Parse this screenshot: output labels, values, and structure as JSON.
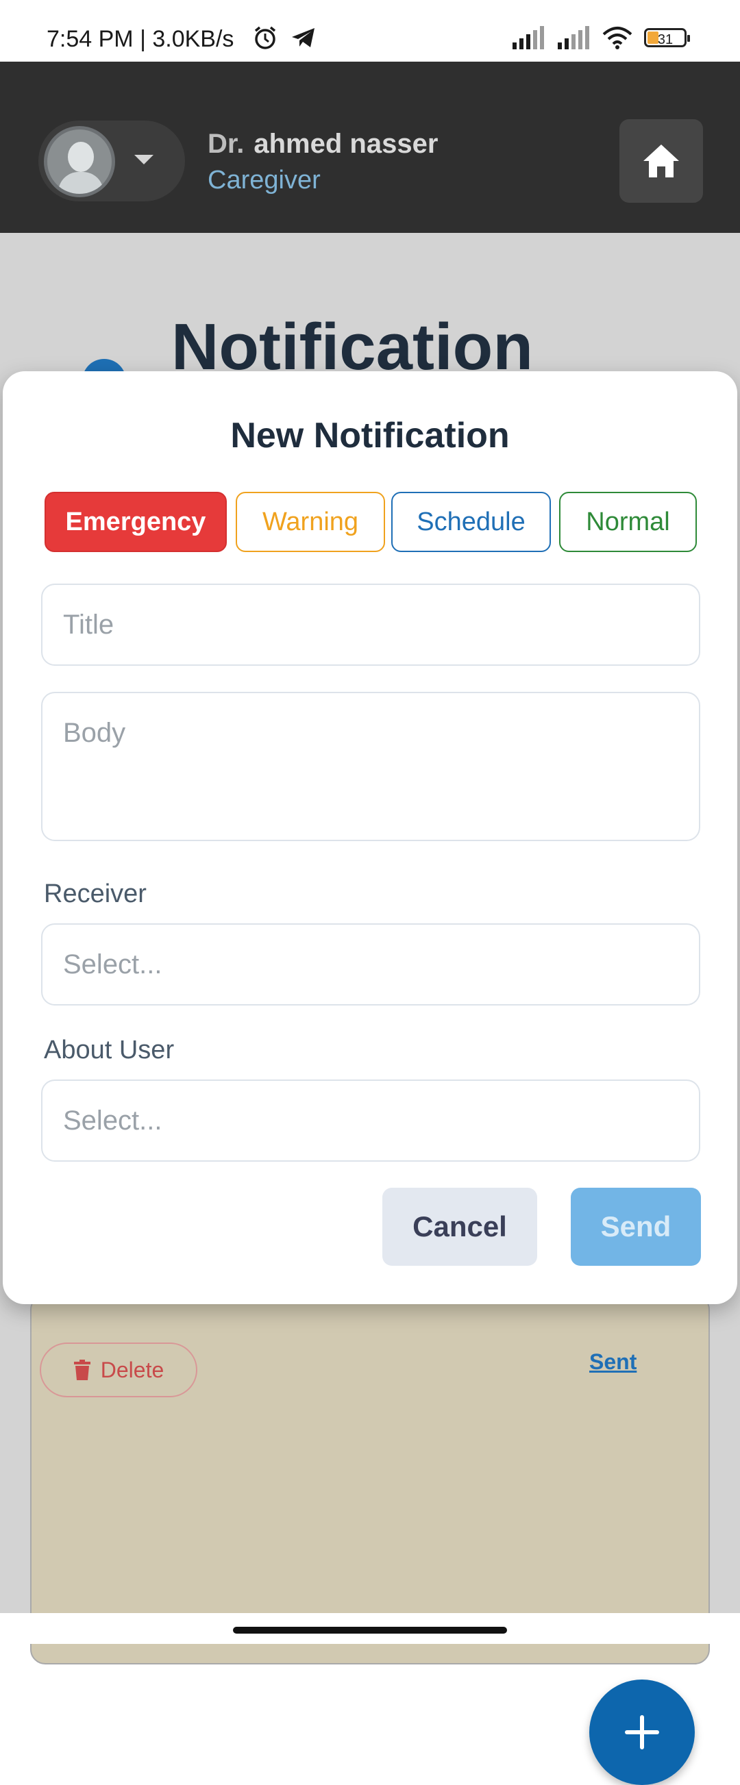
{
  "status_bar": {
    "time_network": "7:54 PM | 3.0KB/s",
    "battery": "31",
    "icons": [
      "alarm-icon",
      "telegram-icon",
      "signal-icon",
      "signal-icon",
      "wifi-icon",
      "battery-icon"
    ]
  },
  "header": {
    "prefix": "Dr.",
    "name": "ahmed nasser",
    "role": "Caregiver",
    "home_icon": "home-icon"
  },
  "background": {
    "page_title": "Notification",
    "delete_label": "Delete",
    "sent_label": "Sent",
    "fab_icon": "plus-icon"
  },
  "dialog": {
    "title": "New Notification",
    "types": [
      "Emergency",
      "Warning",
      "Schedule",
      "Normal"
    ],
    "selected_type": "Emergency",
    "title_placeholder": "Title",
    "body_placeholder": "Body",
    "receiver_label": "Receiver",
    "receiver_placeholder": "Select...",
    "about_label": "About User",
    "about_placeholder": "Select...",
    "cancel_label": "Cancel",
    "send_label": "Send"
  },
  "colors": {
    "emergency": "#e63a3a",
    "warning": "#f0a21e",
    "schedule": "#1f6fb6",
    "normal": "#2e8a38",
    "send": "#72b5e6",
    "appbar": "#2f2f2f"
  }
}
